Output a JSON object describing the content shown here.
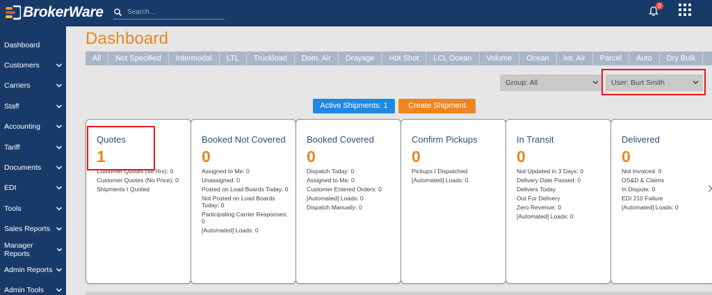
{
  "app": {
    "logo_text": "BrokerWare"
  },
  "search": {
    "placeholder": "Search..."
  },
  "notifications": {
    "count": "0"
  },
  "sidebar": {
    "items": [
      {
        "label": "Dashboard",
        "has_chevron": false
      },
      {
        "label": "Customers",
        "has_chevron": true
      },
      {
        "label": "Carriers",
        "has_chevron": true
      },
      {
        "label": "Staff",
        "has_chevron": true
      },
      {
        "label": "Accounting",
        "has_chevron": true
      },
      {
        "label": "Tariff",
        "has_chevron": true
      },
      {
        "label": "Documents",
        "has_chevron": true
      },
      {
        "label": "EDI",
        "has_chevron": true
      },
      {
        "label": "Tools",
        "has_chevron": true
      },
      {
        "label": "Sales Reports",
        "has_chevron": true
      },
      {
        "label": "Manager Reports",
        "has_chevron": true
      },
      {
        "label": "Admin Reports",
        "has_chevron": true
      },
      {
        "label": "Admin Tools",
        "has_chevron": true
      }
    ]
  },
  "page": {
    "title": "Dashboard"
  },
  "tabs": [
    "All",
    "Not Specified",
    "Intermodal",
    "LTL",
    "Truckload",
    "Dom. Air",
    "Drayage",
    "Hot Shot",
    "LCL Ocean",
    "Volume",
    "Ocean",
    "Int. Air",
    "Parcel",
    "Auto",
    "Dry Bulk"
  ],
  "filters": {
    "group_label": "Group: All",
    "user_label": "User: Burt Smith"
  },
  "buttons": {
    "active_shipments": "Active Shipments: 1",
    "create_shipment": "Create Shipment"
  },
  "cards": [
    {
      "title": "Quotes",
      "count": "1",
      "lines": [
        "Customer Quotes (48 Hrs): 0",
        "Customer Quotes (No Price): 0",
        "Shipments I Quoted"
      ]
    },
    {
      "title": "Booked Not Covered",
      "count": "0",
      "lines": [
        "Assigned to Me: 0",
        "Unassigned: 0",
        "Posted on Load Boards Today: 0",
        "Not Posted on Load Boards Today: 0",
        "Participating Carrier Responses: 0",
        "[Automated] Loads: 0"
      ]
    },
    {
      "title": "Booked Covered",
      "count": "0",
      "lines": [
        "Dispatch Today: 0",
        "Assigned to Me: 0",
        "Customer Entered Orders: 0",
        "[Automated] Loads: 0",
        "Dispatch Manually: 0"
      ]
    },
    {
      "title": "Confirm Pickups",
      "count": "0",
      "lines": [
        "Pickups I Dispatched",
        "[Automated] Loads: 0"
      ]
    },
    {
      "title": "In Transit",
      "count": "0",
      "lines": [
        "Not Updated in 3 Days: 0",
        "Delivery Date Passed: 0",
        "Delivers Today",
        "Out For Delivery",
        "Zero Revenue: 0",
        "[Automated] Loads: 0"
      ]
    },
    {
      "title": "Delivered",
      "count": "0",
      "lines": [
        "Not Invoiced: 0",
        "OS&D & Claims",
        "In Dispute: 0",
        "EDI 210 Failure",
        "[Automated] Loads: 0"
      ]
    }
  ],
  "colors": {
    "navy": "#173a69",
    "orange": "#e8861f",
    "blue_button": "#1e88e5",
    "highlight_red": "#e3161c",
    "title_blue": "#2b4e7e"
  }
}
